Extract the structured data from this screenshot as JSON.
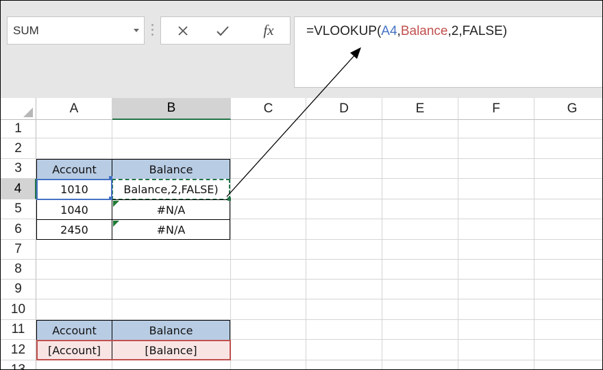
{
  "name_box": {
    "value": "SUM"
  },
  "formula_bar": {
    "cancel_label": "✕",
    "enter_label": "✓",
    "fx_label": "fx",
    "parts": [
      {
        "text": "=VLOOKUP(",
        "color": "#222222"
      },
      {
        "text": "A4",
        "color": "#4472c4"
      },
      {
        "text": ",",
        "color": "#222222"
      },
      {
        "text": "Balance",
        "color": "#c0504d"
      },
      {
        "text": ",2,FALSE)",
        "color": "#222222"
      }
    ]
  },
  "columns": [
    "A",
    "B",
    "C",
    "D",
    "E",
    "F",
    "G"
  ],
  "rows": [
    "1",
    "2",
    "3",
    "4",
    "5",
    "6",
    "7",
    "8",
    "9",
    "10",
    "11",
    "12",
    "13"
  ],
  "selected_column": "B",
  "selected_row": "4",
  "table1": {
    "header_account": "Account",
    "header_balance": "Balance",
    "rows": [
      {
        "account": "1010",
        "balance": "Balance,2,FALSE)"
      },
      {
        "account": "1040",
        "balance": "#N/A"
      },
      {
        "account": "2450",
        "balance": "#N/A"
      }
    ]
  },
  "table2": {
    "header_account": "Account",
    "header_balance": "Balance",
    "row": {
      "account": "[Account]",
      "balance": "[Balance]"
    }
  },
  "colors": {
    "header_fill": "#b8cce4",
    "active_cell_border": "#217346",
    "referenced_cell_border": "#4472c4",
    "named_range_border": "#c0504d",
    "error_indicator": "#1e7b34"
  }
}
